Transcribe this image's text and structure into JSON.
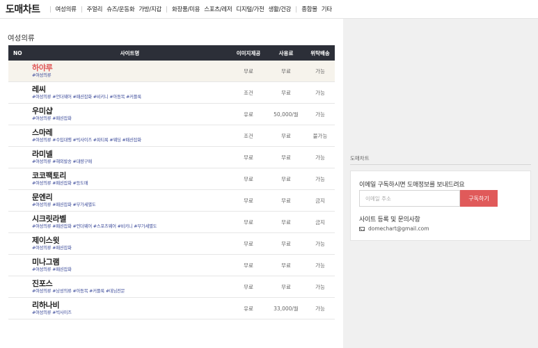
{
  "header": {
    "logo": "도매차트",
    "nav": [
      "여성의류",
      "주얼리",
      "슈즈/운동화",
      "가방/지갑",
      "화장품/미용",
      "스포츠/레저",
      "디지털/가전",
      "생활/건강",
      "종합몰",
      "기타"
    ]
  },
  "section": {
    "title": "여성의류"
  },
  "table": {
    "headers": {
      "no": "NO",
      "site": "사이트명",
      "image": "이미지제공",
      "usage": "사용료",
      "delivery": "위탁배송"
    },
    "rows": [
      {
        "name": "하야루",
        "tags": "#여성의류",
        "image": "무료",
        "usage": "무료",
        "delivery": "가능"
      },
      {
        "name": "레씨",
        "tags": "#여성의류 #언더웨어 #패션잡화 #비키니 #아동복 #커플룩",
        "image": "조건",
        "usage": "무료",
        "delivery": "가능"
      },
      {
        "name": "우미샵",
        "tags": "#여성의류 #패션잡화",
        "image": "유료",
        "usage": "50,000/월",
        "delivery": "가능"
      },
      {
        "name": "스마레",
        "tags": "#여성의류 #수입대행 #빅사이즈 #파티룩 #웨딩 #패션잡화",
        "image": "조건",
        "usage": "무료",
        "delivery": "불가능"
      },
      {
        "name": "라미넬",
        "tags": "#여성의류 #해외발송 #대량구매",
        "image": "무료",
        "usage": "무료",
        "delivery": "가능"
      },
      {
        "name": "코코팩토리",
        "tags": "#여성의류 #패션잡화 #등도매",
        "image": "무료",
        "usage": "무료",
        "delivery": "가능"
      },
      {
        "name": "문엔리",
        "tags": "#여성의류 #패션잡화 #부가세별도",
        "image": "무료",
        "usage": "무료",
        "delivery": "금지"
      },
      {
        "name": "시크릿라벨",
        "tags": "#여성의류 #패션잡화 #언더웨어 #스포츠웨어 #비키니 #부가세별도",
        "image": "무료",
        "usage": "무료",
        "delivery": "금지"
      },
      {
        "name": "제이스윗",
        "tags": "#여성의류 #패션잡화",
        "image": "무료",
        "usage": "무료",
        "delivery": "가능"
      },
      {
        "name": "미나그램",
        "tags": "#여성의류 #패션잡화",
        "image": "무료",
        "usage": "무료",
        "delivery": "가능"
      },
      {
        "name": "진포스",
        "tags": "#여성의류 #남성의류 #아동복 #커플룩 #데님전문",
        "image": "무료",
        "usage": "무료",
        "delivery": "가능"
      },
      {
        "name": "리하나비",
        "tags": "#여성의류 #빅사이즈",
        "image": "유료",
        "usage": "33,000/월",
        "delivery": "가능"
      }
    ]
  },
  "sidebar": {
    "label": "도매차트",
    "subscribe_title": "이메일 구독하시면 도매정보를 보내드려요",
    "email_placeholder": "이메일 주소",
    "subscribe_button": "구독하기",
    "contact_title": "사이트 등록 및 문의사항",
    "contact_email": "domechart@gmail.com",
    "contact_icon": "mail-icon"
  },
  "colors": {
    "accent": "#e05a5a",
    "header_bg": "#2c2f38",
    "tag": "#3b4a9a"
  }
}
